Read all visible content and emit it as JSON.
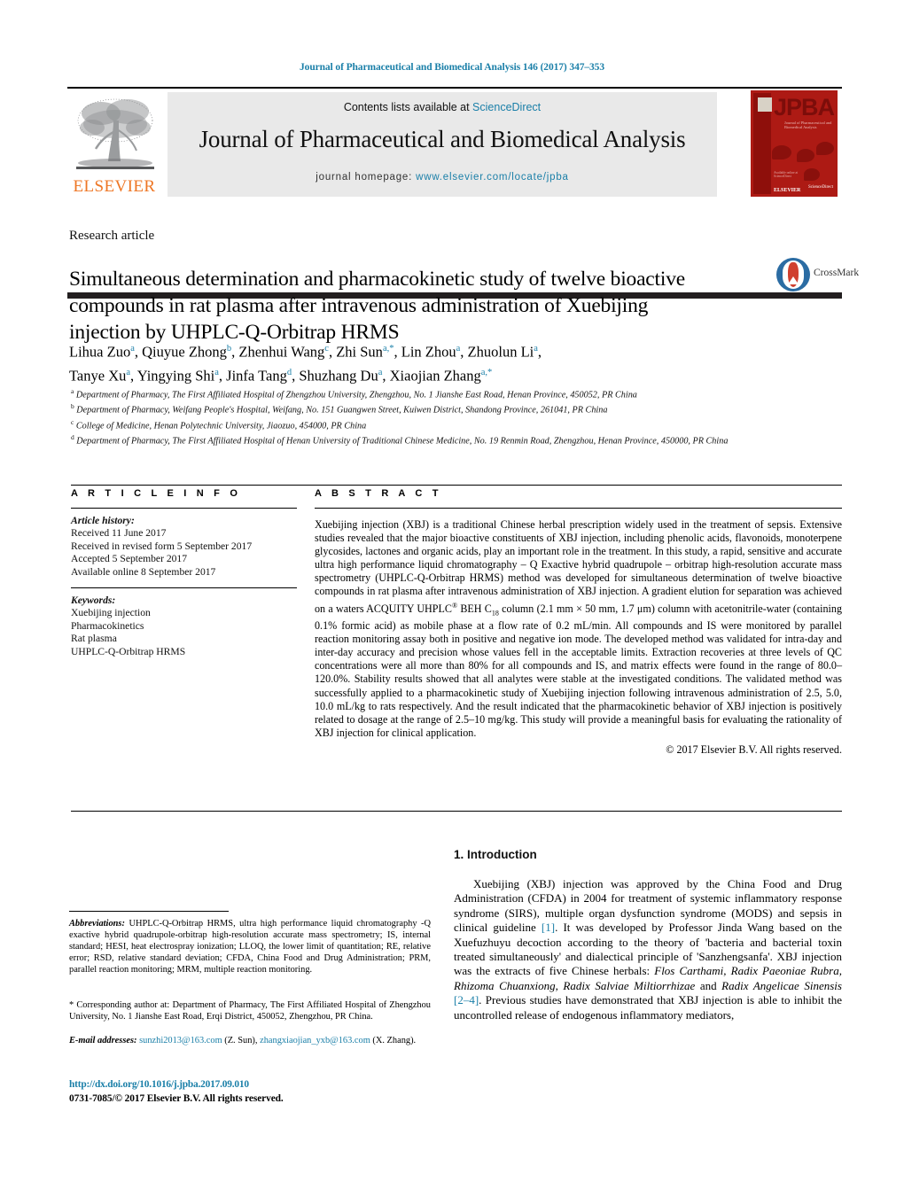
{
  "running_head": "Journal of Pharmaceutical and Biomedical Analysis 146 (2017) 347–353",
  "masthead": {
    "contents_prefix": "Contents lists available at ",
    "sciencedirect": "ScienceDirect",
    "journal_title": "Journal of Pharmaceutical and Biomedical Analysis",
    "homepage_prefix": "journal homepage: ",
    "homepage_url": "www.elsevier.com/locate/jpba",
    "elsevier_wordmark": "ELSEVIER",
    "cover": {
      "acronym": "JPBA",
      "subtitle": "Journal of Pharmaceutical and Biomedical Analysis",
      "publisher": "ELSEVIER",
      "platform": "Available online at ScienceDirect"
    },
    "accent_color": "#1a7fa8",
    "elsevier_orange": "#ee7624",
    "cover_red": "#ad1a14"
  },
  "article": {
    "type": "Research article",
    "title": "Simultaneous determination and pharmacokinetic study of twelve bioactive compounds in rat plasma after intravenous administration of Xuebijing injection by UHPLC-Q-Orbitrap HRMS",
    "crossmark_label": "CrossMark",
    "authors_line_1": [
      {
        "name": "Lihua Zuo",
        "sup": "a"
      },
      {
        "name": "Qiuyue Zhong",
        "sup": "b"
      },
      {
        "name": "Zhenhui Wang",
        "sup": "c"
      },
      {
        "name": "Zhi Sun",
        "sup": "a,*"
      },
      {
        "name": "Lin Zhou",
        "sup": "a"
      },
      {
        "name": "Zhuolun Li",
        "sup": "a"
      }
    ],
    "authors_line_2": [
      {
        "name": "Tanye Xu",
        "sup": "a"
      },
      {
        "name": "Yingying Shi",
        "sup": "a"
      },
      {
        "name": "Jinfa Tang",
        "sup": "d"
      },
      {
        "name": "Shuzhang Du",
        "sup": "a"
      },
      {
        "name": "Xiaojian Zhang",
        "sup": "a,*"
      }
    ],
    "affiliations": [
      {
        "marker": "a",
        "text": "Department of Pharmacy, The First Affiliated Hospital of Zhengzhou University, Zhengzhou, No. 1 Jianshe East Road, Henan Province, 450052, PR China"
      },
      {
        "marker": "b",
        "text": "Department of Pharmacy, Weifang People's Hospital, Weifang, No. 151 Guangwen Street, Kuiwen District, Shandong Province, 261041, PR China"
      },
      {
        "marker": "c",
        "text": "College of Medicine, Henan Polytechnic University, Jiaozuo, 454000, PR China"
      },
      {
        "marker": "d",
        "text": "Department of Pharmacy, The First Affiliated Hospital of Henan University of Traditional Chinese Medicine, No. 19 Renmin Road, Zhengzhou, Henan Province, 450000, PR China"
      }
    ]
  },
  "article_info": {
    "label": "A R T I C L E  I N F O",
    "history_title": "Article history:",
    "history": [
      "Received 11 June 2017",
      "Received in revised form 5 September 2017",
      "Accepted 5 September 2017",
      "Available online 8 September 2017"
    ],
    "keywords_title": "Keywords:",
    "keywords": [
      "Xuebijing injection",
      "Pharmacokinetics",
      "Rat plasma",
      "UHPLC-Q-Orbitrap HRMS"
    ]
  },
  "abstract": {
    "label": "A B S T R A C T",
    "part1": "Xuebijing injection (XBJ) is a traditional Chinese herbal prescription widely used in the treatment of sepsis. Extensive studies revealed that the major bioactive constituents of XBJ injection, including phenolic acids, flavonoids, monoterpene glycosides, lactones and organic acids, play an important role in the treatment. In this study, a rapid, sensitive and accurate ultra high performance liquid chromatography – Q Exactive hybrid quadrupole – orbitrap high-resolution accurate mass spectrometry (UHPLC-Q-Orbitrap HRMS) method was developed for simultaneous determination of twelve bioactive compounds in rat plasma after intravenous administration of XBJ injection. A gradient elution for separation was achieved on a waters ACQUITY UHPLC",
    "reg_mark": "®",
    "part2": " BEH C",
    "sub18": "18",
    "part3": " column (2.1 mm × 50 mm, 1.7 μm) column with acetonitrile-water (containing 0.1% formic acid) as mobile phase at a flow rate of 0.2 mL/min. All compounds and IS were monitored by parallel reaction monitoring assay both in positive and negative ion mode. The developed method was validated for intra-day and inter-day accuracy and precision whose values fell in the acceptable limits. Extraction recoveries at three levels of QC concentrations were all more than 80% for all compounds and IS, and matrix effects were found in the range of 80.0–120.0%. Stability results showed that all analytes were stable at the investigated conditions. The validated method was successfully applied to a pharmacokinetic study of Xuebijing injection following intravenous administration of 2.5, 5.0, 10.0 mL/kg to rats respectively. And the result indicated that the pharmacokinetic behavior of XBJ injection is positively related to dosage at the range of 2.5–10 mg/kg. This study will provide a meaningful basis for evaluating the rationality of XBJ injection for clinical application.",
    "copyright": "© 2017 Elsevier B.V. All rights reserved."
  },
  "introduction": {
    "heading": "1.  Introduction",
    "p1_a": "Xuebijing (XBJ) injection was approved by the China Food and Drug Administration (CFDA) in 2004 for treatment of systemic inflammatory response syndrome (SIRS), multiple organ dysfunction syndrome (MODS) and sepsis in clinical guideline ",
    "ref1": "[1]",
    "p1_b": ". It was developed by Professor Jinda Wang based on the Xuefuzhuyu decoction according to the theory of 'bacteria and bacterial toxin treated simultaneously' and dialectical principle of 'Sanzhengsanfa'. XBJ injection was the extracts of five Chinese herbals: ",
    "herbs_1": "Flos Carthami, Radix Paeoniae Rubra, Rhizoma Chuanxiong, Radix Salviae Miltiorrhizae",
    "p1_c": " and ",
    "herbs_2": "Radix Angelicae Sinensis",
    "p1_d": " ",
    "ref2": "[2–4]",
    "p1_e": ". Previous studies have demonstrated that XBJ injection is able to inhibit the uncontrolled release of endogenous inflammatory mediators,"
  },
  "footnotes": {
    "abbrev_label": "Abbreviations:",
    "abbrev_text": "  UHPLC-Q-Orbitrap HRMS, ultra high performance liquid chromatography -Q exactive hybrid quadrupole-orbitrap high-resolution accurate mass spectrometry; IS, internal standard; HESI, heat electrospray ionization; LLOQ, the lower limit of quantitation; RE, relative error; RSD, relative standard deviation; CFDA, China Food and Drug Administration; PRM, parallel reaction monitoring; MRM, multiple reaction monitoring.",
    "corresponding": "* Corresponding author at: Department of Pharmacy, The First Affiliated Hospital of Zhengzhou University, No. 1 Jianshe East Road, Erqi District, 450052, Zhengzhou, PR China.",
    "email_label": "E-mail addresses:",
    "email_1": "sunzhi2013@163.com",
    "email_1_owner": " (Z. Sun), ",
    "email_2": "zhangxiaojian_yxb@163.com",
    "email_2_owner": " (X. Zhang).",
    "doi": "http://dx.doi.org/10.1016/j.jpba.2017.09.010",
    "issn": "0731-7085/© 2017 Elsevier B.V. All rights reserved."
  }
}
